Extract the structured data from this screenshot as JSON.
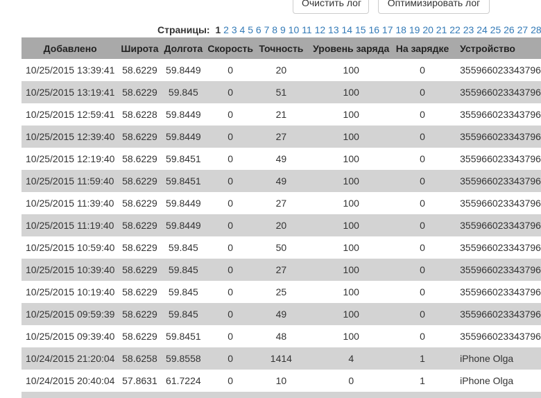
{
  "toolbar": {
    "clear_label": "Очистить лог",
    "optimize_label": "Оптимизировать лог"
  },
  "pagination": {
    "label": "Страницы:",
    "current": "1",
    "pages": [
      "1",
      "2",
      "3",
      "4",
      "5",
      "6",
      "7",
      "8",
      "9",
      "10",
      "11",
      "12",
      "13",
      "14",
      "15",
      "16",
      "17",
      "18",
      "19",
      "20",
      "21",
      "22",
      "23",
      "24",
      "25",
      "26",
      "27",
      "28"
    ]
  },
  "table": {
    "headers": [
      "Добавлено",
      "Широта",
      "Долгота",
      "Скорость",
      "Точность",
      "Уровень заряда",
      "На зарядке",
      "Устройство"
    ],
    "rows": [
      [
        "10/25/2015 13:39:41",
        "58.6229",
        "59.8449",
        "0",
        "20",
        "100",
        "0",
        "355966023343796"
      ],
      [
        "10/25/2015 13:19:41",
        "58.6229",
        "59.845",
        "0",
        "51",
        "100",
        "0",
        "355966023343796"
      ],
      [
        "10/25/2015 12:59:41",
        "58.6228",
        "59.8449",
        "0",
        "21",
        "100",
        "0",
        "355966023343796"
      ],
      [
        "10/25/2015 12:39:40",
        "58.6229",
        "59.8449",
        "0",
        "27",
        "100",
        "0",
        "355966023343796"
      ],
      [
        "10/25/2015 12:19:40",
        "58.6229",
        "59.8451",
        "0",
        "49",
        "100",
        "0",
        "355966023343796"
      ],
      [
        "10/25/2015 11:59:40",
        "58.6229",
        "59.8451",
        "0",
        "49",
        "100",
        "0",
        "355966023343796"
      ],
      [
        "10/25/2015 11:39:40",
        "58.6229",
        "59.8449",
        "0",
        "27",
        "100",
        "0",
        "355966023343796"
      ],
      [
        "10/25/2015 11:19:40",
        "58.6229",
        "59.8449",
        "0",
        "20",
        "100",
        "0",
        "355966023343796"
      ],
      [
        "10/25/2015 10:59:40",
        "58.6229",
        "59.845",
        "0",
        "50",
        "100",
        "0",
        "355966023343796"
      ],
      [
        "10/25/2015 10:39:40",
        "58.6229",
        "59.845",
        "0",
        "27",
        "100",
        "0",
        "355966023343796"
      ],
      [
        "10/25/2015 10:19:40",
        "58.6229",
        "59.845",
        "0",
        "25",
        "100",
        "0",
        "355966023343796"
      ],
      [
        "10/25/2015 09:59:39",
        "58.6229",
        "59.845",
        "0",
        "49",
        "100",
        "0",
        "355966023343796"
      ],
      [
        "10/25/2015 09:39:40",
        "58.6229",
        "59.8451",
        "0",
        "48",
        "100",
        "0",
        "355966023343796"
      ],
      [
        "10/24/2015 21:20:04",
        "58.6258",
        "59.8558",
        "0",
        "1414",
        "4",
        "1",
        "iPhone Olga"
      ],
      [
        "10/24/2015 20:40:04",
        "57.8631",
        "61.7224",
        "0",
        "10",
        "0",
        "1",
        "iPhone Olga"
      ],
      [
        "",
        "",
        "",
        "",
        "",
        "",
        "",
        ""
      ]
    ]
  }
}
